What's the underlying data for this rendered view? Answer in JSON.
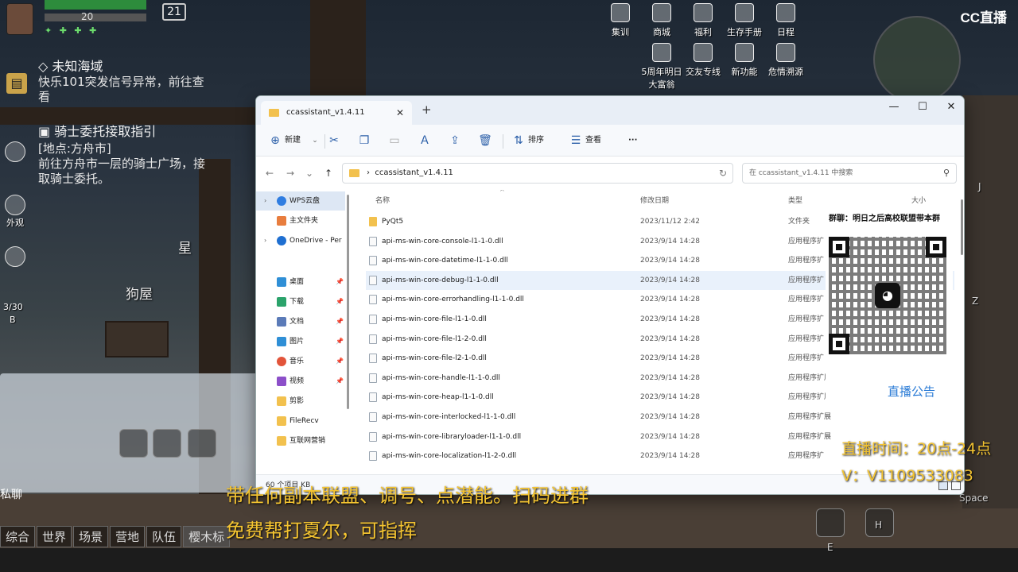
{
  "game": {
    "player_level": "20",
    "day_counter": "21",
    "quests": [
      {
        "title": "未知海域",
        "body_line1": "快乐101突发信号异常，前往查",
        "body_line2": "看"
      },
      {
        "title": "骑士委托接取指引",
        "body_line1": "[地点:方舟市]",
        "body_line2": "前往方舟市一层的骑士广场，接",
        "body_line3": "取骑士委托。"
      }
    ],
    "side_labels": {
      "appearance": "外观",
      "star": "星",
      "kennel": "狗屋",
      "bottom_count": "3/30",
      "bottom_key": "B"
    },
    "top_menu": [
      {
        "label": "集训"
      },
      {
        "label": "商城"
      },
      {
        "label": "福利"
      },
      {
        "label": "生存手册"
      },
      {
        "label": "日程"
      },
      {
        "label": "5周年明日大富翁"
      },
      {
        "label": "交友专线"
      },
      {
        "label": "新功能"
      },
      {
        "label": "危情溯源"
      }
    ],
    "chat_private": "私聊",
    "chat_tabs": [
      "综合",
      "世界",
      "场景",
      "营地",
      "队伍",
      "樱木标"
    ],
    "key_hints": {
      "e": "E",
      "h": "H",
      "space": "Space",
      "z": "Z",
      "j": "J"
    }
  },
  "stream": {
    "logo": "CC直播",
    "line1": "带任何副本联盟、调号、点潜能。扫码进群",
    "line2": "免费帮打夏尔，可指挥",
    "time": "直播时间：20点-24点",
    "contact": "V：V1109533083",
    "qr_title": "群聊：明日之后高校联盟带本群",
    "notice": "直播公告"
  },
  "explorer": {
    "tab_title": "ccassistant_v1.4.11",
    "toolbar": {
      "new": "新建",
      "sort": "排序",
      "view": "查看",
      "more": "···"
    },
    "address": "ccassistant_v1.4.11",
    "search_placeholder": "在 ccassistant_v1.4.11 中搜索",
    "columns": {
      "name": "名称",
      "date": "修改日期",
      "type": "类型",
      "size": "大小"
    },
    "nav": [
      {
        "label": "WPS云盘",
        "color": "#2f7de1"
      },
      {
        "label": "主文件夹",
        "color": "#e87d3e"
      },
      {
        "label": "OneDrive - Per",
        "color": "#1f6fd1"
      },
      {
        "label": "桌面",
        "color": "#2f8fd6"
      },
      {
        "label": "下载",
        "color": "#2ba36b"
      },
      {
        "label": "文档",
        "color": "#5b7bb8"
      },
      {
        "label": "图片",
        "color": "#2f8fd6"
      },
      {
        "label": "音乐",
        "color": "#e2543a"
      },
      {
        "label": "视频",
        "color": "#8c4fc9"
      },
      {
        "label": "剪影",
        "color": "#f2c14e"
      },
      {
        "label": "FileRecv",
        "color": "#f2c14e"
      },
      {
        "label": "互联网营销",
        "color": "#f2c14e"
      }
    ],
    "files": [
      {
        "name": "PyQt5",
        "date": "2023/11/12 2:42",
        "type": "文件夹",
        "kind": "folder"
      },
      {
        "name": "api-ms-win-core-console-l1-1-0.dll",
        "date": "2023/9/14 14:28",
        "type": "应用程序扩",
        "kind": "dll"
      },
      {
        "name": "api-ms-win-core-datetime-l1-1-0.dll",
        "date": "2023/9/14 14:28",
        "type": "应用程序扩",
        "kind": "dll"
      },
      {
        "name": "api-ms-win-core-debug-l1-1-0.dll",
        "date": "2023/9/14 14:28",
        "type": "应用程序扩",
        "kind": "dll"
      },
      {
        "name": "api-ms-win-core-errorhandling-l1-1-0.dll",
        "date": "2023/9/14 14:28",
        "type": "应用程序扩",
        "kind": "dll"
      },
      {
        "name": "api-ms-win-core-file-l1-1-0.dll",
        "date": "2023/9/14 14:28",
        "type": "应用程序扩",
        "kind": "dll"
      },
      {
        "name": "api-ms-win-core-file-l1-2-0.dll",
        "date": "2023/9/14 14:28",
        "type": "应用程序扩",
        "kind": "dll"
      },
      {
        "name": "api-ms-win-core-file-l2-1-0.dll",
        "date": "2023/9/14 14:28",
        "type": "应用程序扩",
        "kind": "dll"
      },
      {
        "name": "api-ms-win-core-handle-l1-1-0.dll",
        "date": "2023/9/14 14:28",
        "type": "应用程序扩展",
        "kind": "dll"
      },
      {
        "name": "api-ms-win-core-heap-l1-1-0.dll",
        "date": "2023/9/14 14:28",
        "type": "应用程序扩展",
        "kind": "dll"
      },
      {
        "name": "api-ms-win-core-interlocked-l1-1-0.dll",
        "date": "2023/9/14 14:28",
        "type": "应用程序扩展",
        "kind": "dll"
      },
      {
        "name": "api-ms-win-core-libraryloader-l1-1-0.dll",
        "date": "2023/9/14 14:28",
        "type": "应用程序扩展",
        "kind": "dll"
      },
      {
        "name": "api-ms-win-core-localization-l1-2-0.dll",
        "date": "2023/9/14 14:28",
        "type": "应用程序扩",
        "kind": "dll"
      }
    ],
    "status": "60 个项目   KB"
  }
}
